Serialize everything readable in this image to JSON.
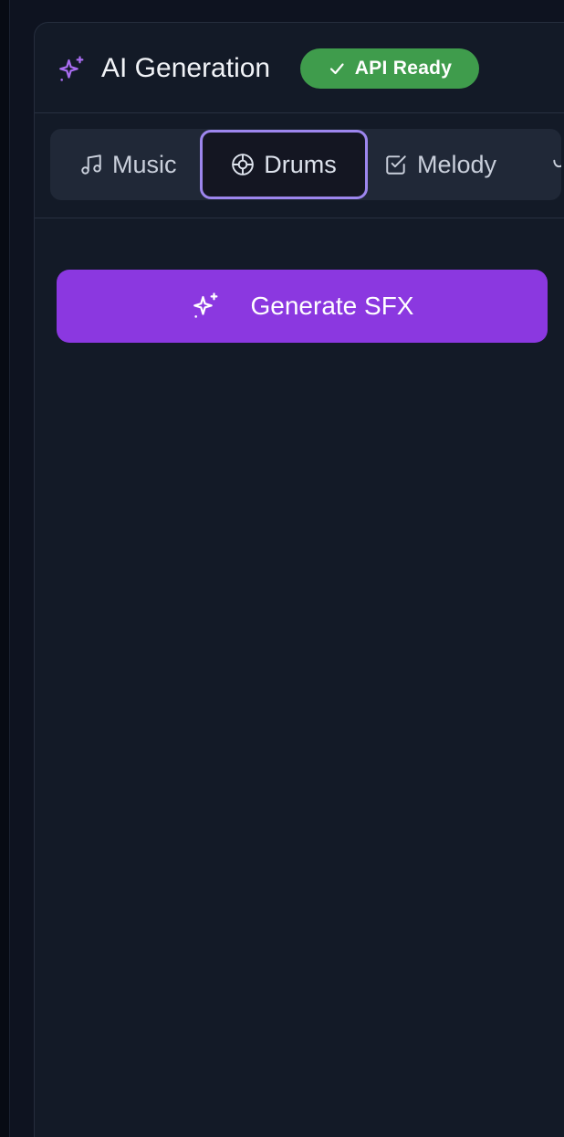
{
  "header": {
    "title": "AI Generation",
    "status_badge": "API Ready",
    "icon": "sparkle-icon",
    "status_color": "#3f9c4c",
    "accent": "#a86cf0"
  },
  "tabs": [
    {
      "label": "Music",
      "icon": "music-note-icon",
      "selected": false
    },
    {
      "label": "Drums",
      "icon": "drum-icon",
      "selected": true
    },
    {
      "label": "Melody",
      "icon": "checkbox-icon",
      "selected": false
    }
  ],
  "actions": {
    "generate_label": "Generate SFX",
    "generate_icon": "sparkle-icon",
    "generate_color": "#8b38e0"
  }
}
